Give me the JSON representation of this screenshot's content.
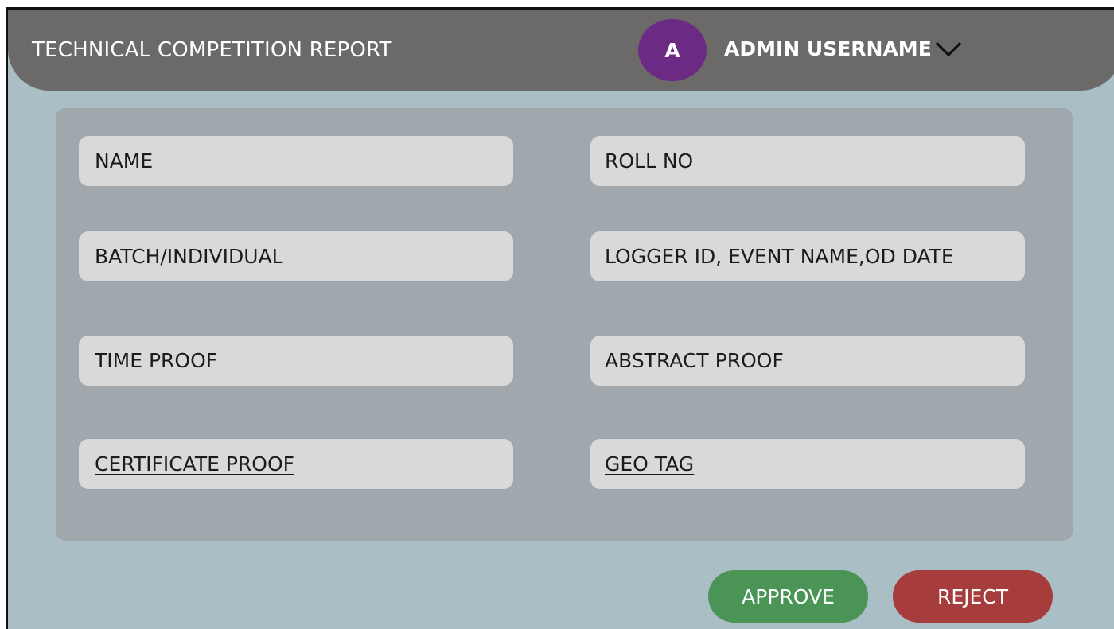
{
  "header": {
    "title": "TECHNICAL COMPETITION REPORT",
    "avatar_initial": "A",
    "username": "ADMIN USERNAME",
    "dropdown_icon": "chevron-down-icon"
  },
  "form": {
    "fields": [
      {
        "label": "NAME",
        "link": false
      },
      {
        "label": "ROLL NO",
        "link": false
      },
      {
        "label": "BATCH/INDIVIDUAL",
        "link": false
      },
      {
        "label": "LOGGER ID, EVENT NAME,OD DATE",
        "link": false
      },
      {
        "label": "TIME PROOF",
        "link": true
      },
      {
        "label": "ABSTRACT PROOF",
        "link": true
      },
      {
        "label": "CERTIFICATE PROOF",
        "link": true
      },
      {
        "label": "GEO TAG",
        "link": true
      }
    ]
  },
  "actions": {
    "approve_label": "APPROVE",
    "reject_label": "REJECT"
  },
  "colors": {
    "background": "#aabec6",
    "header": "#6b6a68",
    "avatar": "#6b2a83",
    "panel": "#a0a7ad",
    "field": "#d9d9d9",
    "approve": "#4a9556",
    "reject": "#a63c3c"
  }
}
